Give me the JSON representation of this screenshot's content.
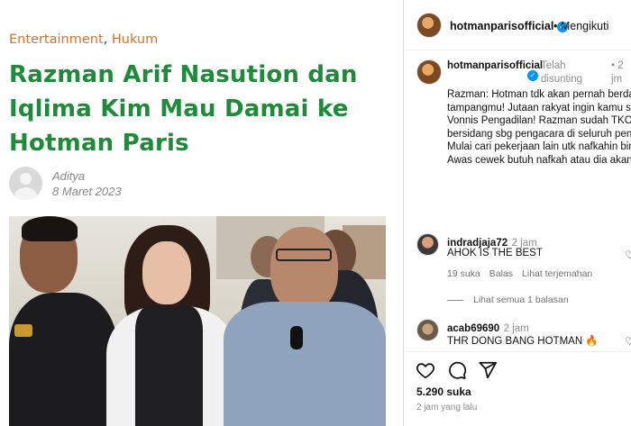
{
  "article": {
    "category_1": "Entertainment",
    "category_sep": ",",
    "category_2": "Hukum",
    "headline": "Razman Arif Nasution dan Iqlima Kim Mau Damai ke Hotman Paris",
    "author": "Aditya",
    "date": "8 Maret 2023"
  },
  "instagram": {
    "header_username": "hotmanparisofficial",
    "follow_label": "• Mengikuti",
    "caption": {
      "username": "hotmanparisofficial",
      "edited_label": "Telah disunting",
      "time": "• 2 jm",
      "text": "Razman: Hotman tdk akan pernah berdamai dgn tampangmu! Jutaan rakyat ingin kamu segera di Vonnis Pengadilan! Razman sudah TKO tdk bisa bersidang sbg pengacara di seluruh pengadilan! Mulai cari pekerjaan lain utk nafkahin bini bini mu! Awas cewek butuh nafkah atau dia akan ........?"
    },
    "comments": [
      {
        "username": "indradjaja72",
        "time": "2 jam",
        "text": "AHOK IS THE BEST",
        "likes": "19 suka",
        "reply_label": "Balas",
        "translate_label": "Lihat terjemahan"
      },
      {
        "username": "acab69690",
        "time": "2 jam",
        "text": "THR DONG BANG HOTMAN 🔥"
      }
    ],
    "view_replies": "Lihat semua 1 balasan",
    "likes": "5.290 suka",
    "posted_ago": "2 jam yang lalu",
    "icons": [
      "heart-icon",
      "comment-icon",
      "share-icon"
    ]
  },
  "colors": {
    "headline": "#1e8a3a",
    "category": "#d0742f",
    "verified": "#0095f6"
  }
}
